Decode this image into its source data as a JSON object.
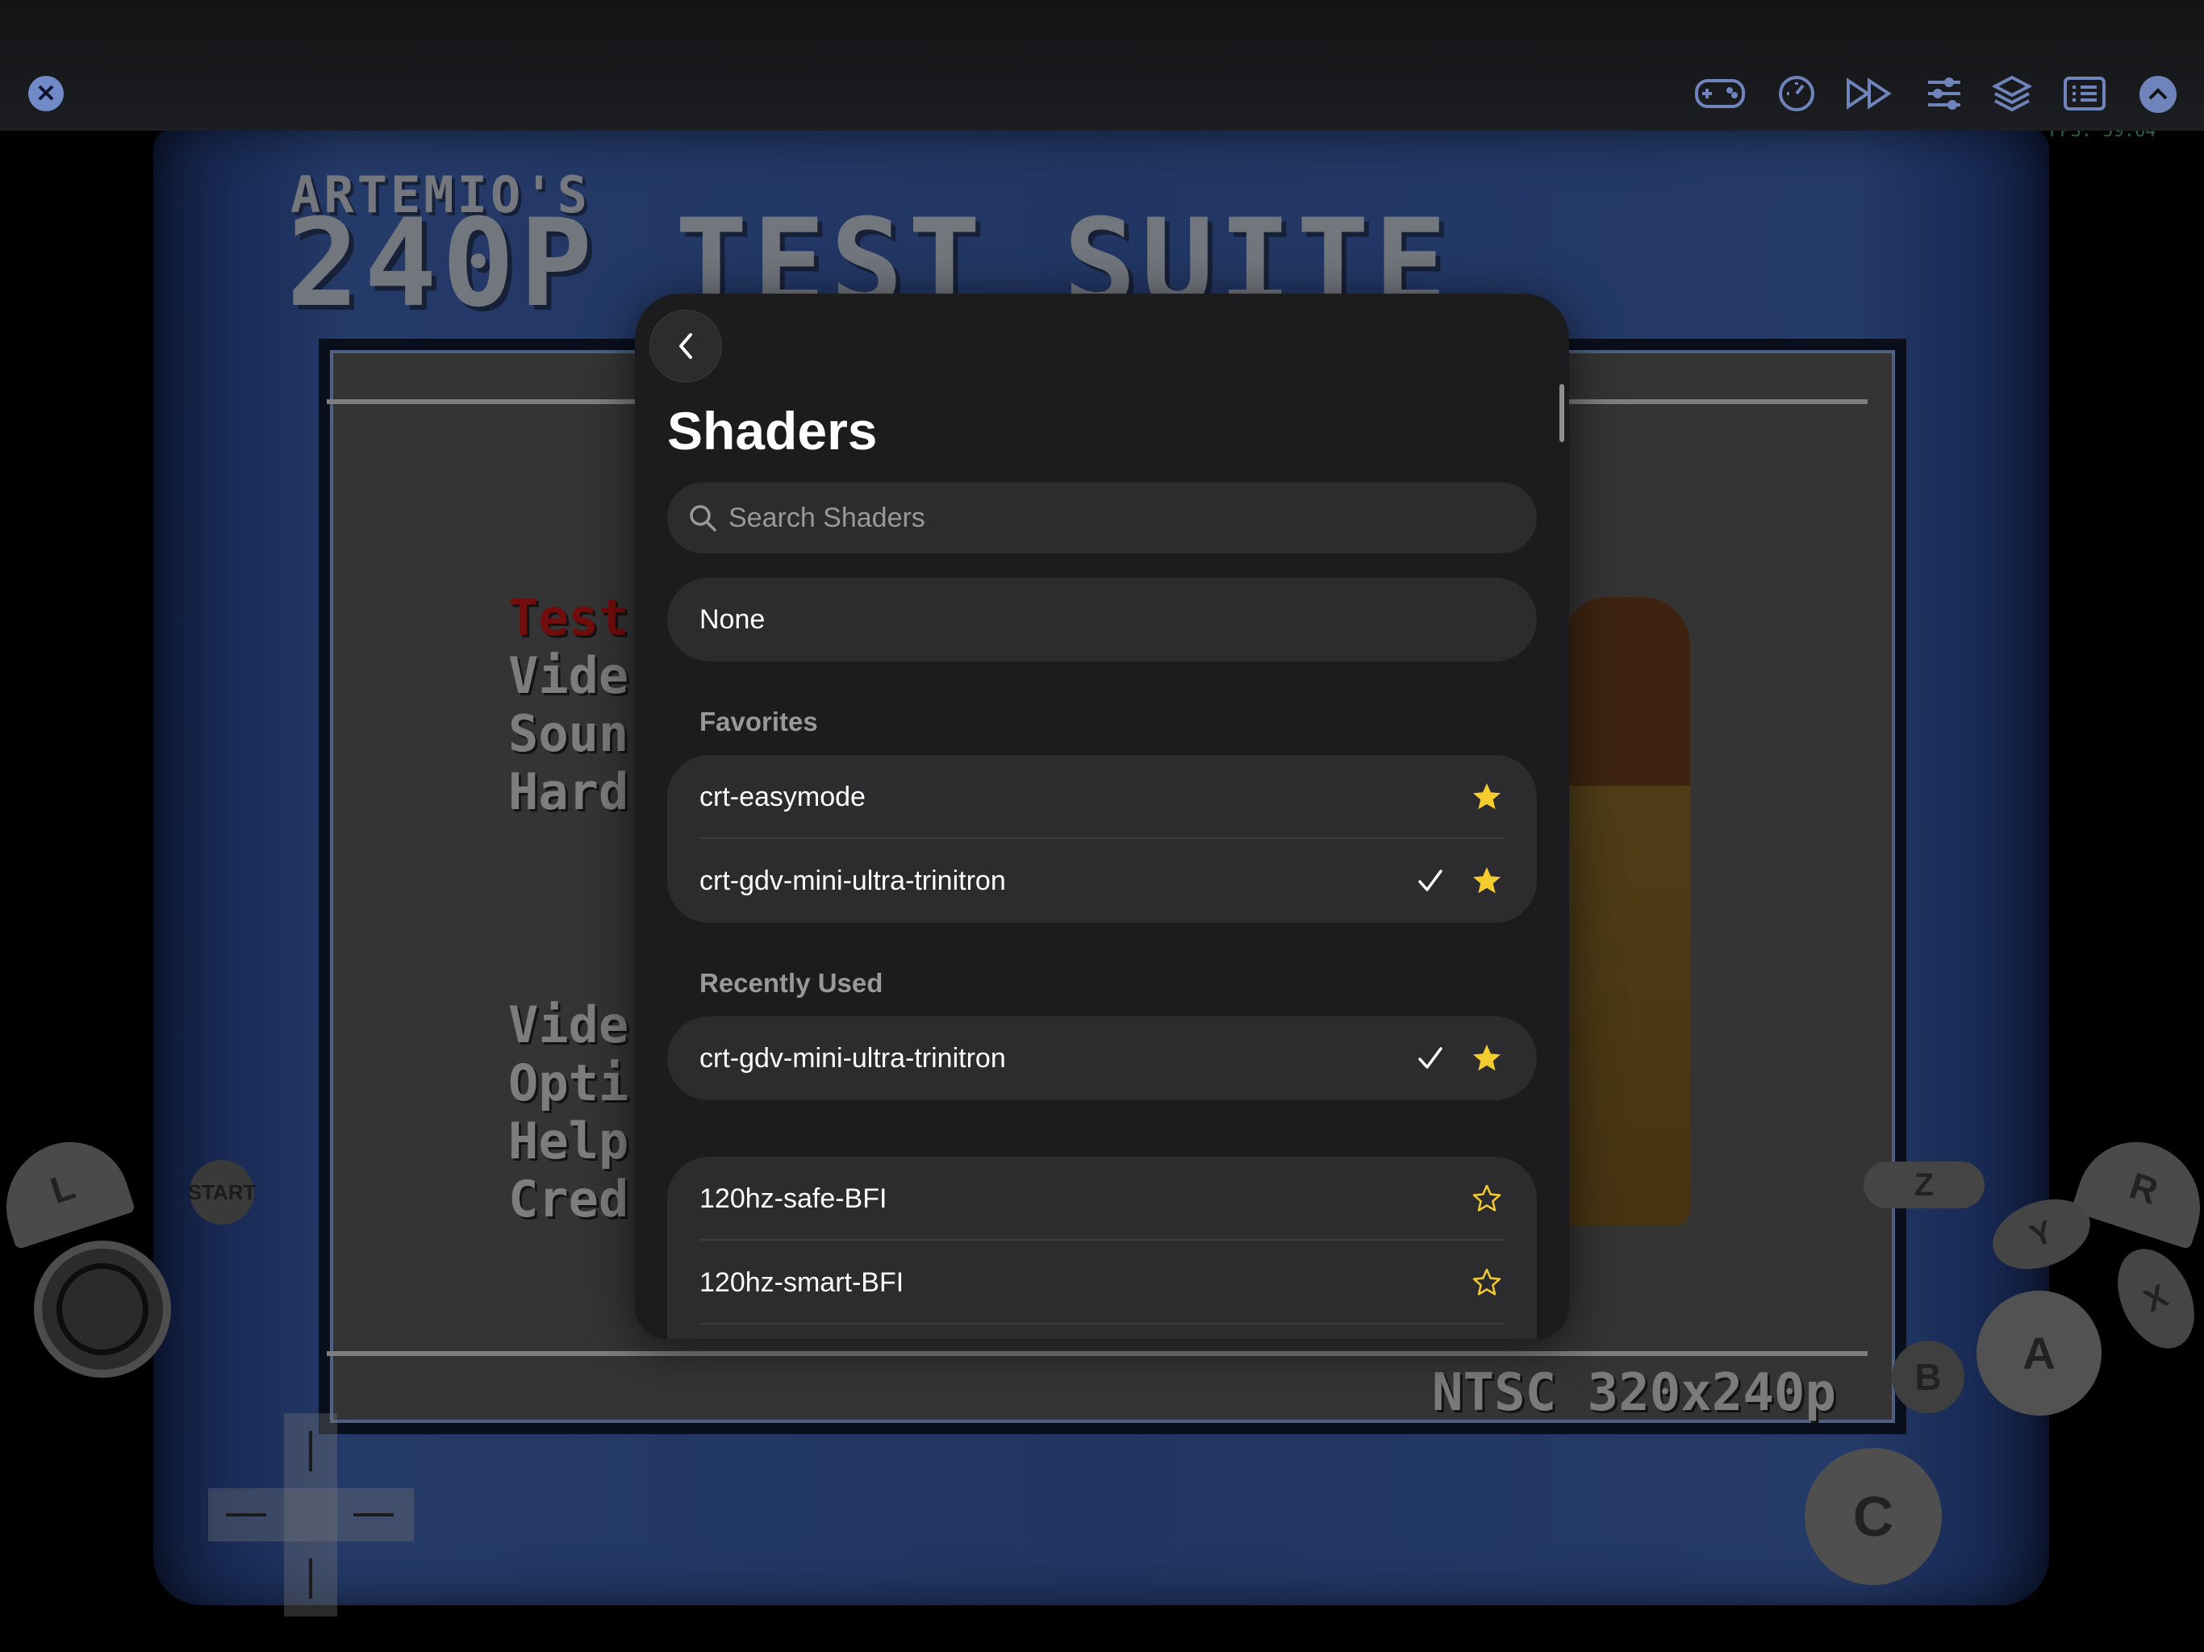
{
  "game": {
    "title_small": "ARTEMIO'S",
    "title_big": "240P TEST SUITE",
    "menu_top": [
      "Test",
      "Vide",
      "Soun",
      "Hard"
    ],
    "menu_bottom": [
      "Vide",
      "Opti",
      "Help",
      "Cred"
    ],
    "resolution": "NTSC 320x240p",
    "fps": "FPS:  59.64"
  },
  "toolbar": {
    "icons": [
      "close-icon",
      "gamepad-icon",
      "speedometer-icon",
      "fast-forward-icon",
      "sliders-icon",
      "layers-icon",
      "list-icon",
      "chevron-up-icon"
    ]
  },
  "controls": {
    "L": "L",
    "R": "R",
    "start": "START",
    "Z": "Z",
    "Y": "Y",
    "X": "X",
    "A": "A",
    "B": "B",
    "C": "C"
  },
  "shaders": {
    "title": "Shaders",
    "search_placeholder": "Search Shaders",
    "none_label": "None",
    "favorites_header": "Favorites",
    "favorites": [
      {
        "name": "crt-easymode",
        "selected": false,
        "favorite": true
      },
      {
        "name": "crt-gdv-mini-ultra-trinitron",
        "selected": true,
        "favorite": true
      }
    ],
    "recent_header": "Recently Used",
    "recent": [
      {
        "name": "crt-gdv-mini-ultra-trinitron",
        "selected": true,
        "favorite": true
      }
    ],
    "all": [
      {
        "name": "120hz-safe-BFI",
        "selected": false,
        "favorite": false
      },
      {
        "name": "120hz-smart-BFI",
        "selected": false,
        "favorite": false
      }
    ]
  },
  "colors": {
    "accent_star": "#f5cc2e",
    "toolbar_icon": "#6e84bb",
    "modal_bg": "#1c1c1e",
    "cell_bg": "#2c2c2e"
  }
}
